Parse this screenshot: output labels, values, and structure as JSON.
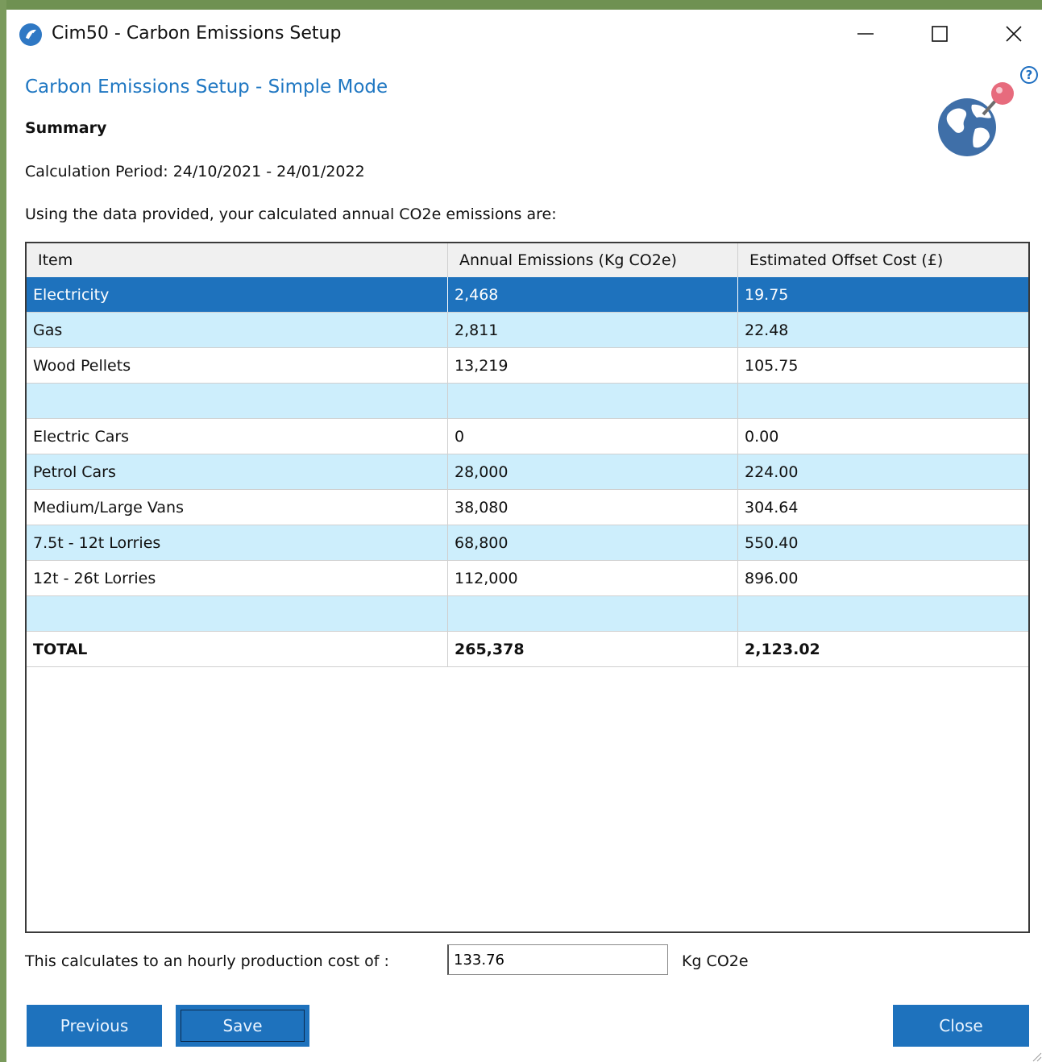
{
  "window": {
    "title": "Cim50 - Carbon Emissions Setup",
    "controls": {
      "minimize": "minimize-icon",
      "maximize": "maximize-icon",
      "close": "close-icon"
    }
  },
  "page": {
    "heading": "Carbon Emissions Setup - Simple Mode",
    "section": "Summary",
    "period": "Calculation Period: 24/10/2021 - 24/01/2022",
    "intro": "Using the data provided, your calculated annual CO2e emissions are:",
    "help_icon_label": "?"
  },
  "table": {
    "columns": [
      "Item",
      "Annual Emissions (Kg CO2e)",
      "Estimated Offset Cost (£)"
    ],
    "rows": [
      {
        "item": "Electricity",
        "emissions": "2,468",
        "cost": "19.75"
      },
      {
        "item": "Gas",
        "emissions": "2,811",
        "cost": "22.48"
      },
      {
        "item": "Wood Pellets",
        "emissions": "13,219",
        "cost": "105.75"
      },
      {
        "item": "",
        "emissions": "",
        "cost": ""
      },
      {
        "item": "Electric Cars",
        "emissions": "0",
        "cost": "0.00"
      },
      {
        "item": "Petrol Cars",
        "emissions": "28,000",
        "cost": "224.00"
      },
      {
        "item": "Medium/Large Vans",
        "emissions": "38,080",
        "cost": "304.64"
      },
      {
        "item": "7.5t - 12t Lorries",
        "emissions": "68,800",
        "cost": "550.40"
      },
      {
        "item": "12t - 26t Lorries",
        "emissions": "112,000",
        "cost": "896.00"
      },
      {
        "item": "",
        "emissions": "",
        "cost": ""
      },
      {
        "item": "TOTAL",
        "emissions": "265,378",
        "cost": "2,123.02"
      }
    ],
    "selected_row": "Electricity"
  },
  "footer": {
    "label": "This calculates to an hourly production cost of :",
    "value": "133.76",
    "unit": "Kg CO2e"
  },
  "buttons": {
    "previous": "Previous",
    "save": "Save",
    "close": "Close"
  },
  "colors": {
    "accent": "#1e72bd",
    "row_alt": "#cdeefc",
    "heading": "#1f77c2"
  }
}
